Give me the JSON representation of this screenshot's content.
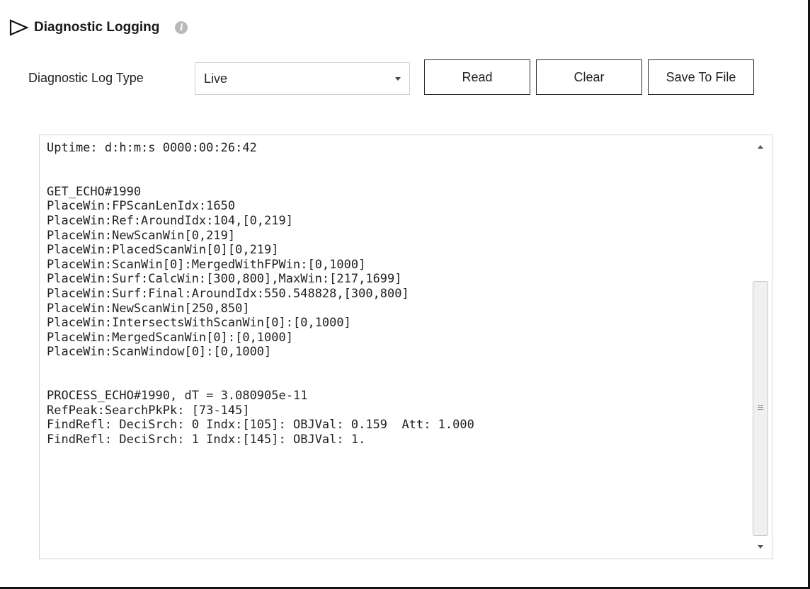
{
  "header": {
    "title": "Diagnostic Logging",
    "expand_icon": "play-triangle-outline",
    "info_icon": "info-circle",
    "info_glyph": "i"
  },
  "controls": {
    "log_type_label": "Diagnostic Log Type",
    "log_type_value": "Live",
    "read_label": "Read",
    "clear_label": "Clear",
    "save_label": "Save To File"
  },
  "log": {
    "lines": [
      "Uptime: d:h:m:s 0000:00:26:42",
      "",
      "",
      "GET_ECHO#1990",
      "PlaceWin:FPScanLenIdx:1650",
      "PlaceWin:Ref:AroundIdx:104,[0,219]",
      "PlaceWin:NewScanWin[0,219]",
      "PlaceWin:PlacedScanWin[0][0,219]",
      "PlaceWin:ScanWin[0]:MergedWithFPWin:[0,1000]",
      "PlaceWin:Surf:CalcWin:[300,800],MaxWin:[217,1699]",
      "PlaceWin:Surf:Final:AroundIdx:550.548828,[300,800]",
      "PlaceWin:NewScanWin[250,850]",
      "PlaceWin:IntersectsWithScanWin[0]:[0,1000]",
      "PlaceWin:MergedScanWin[0]:[0,1000]",
      "PlaceWin:ScanWindow[0]:[0,1000]",
      "",
      "",
      "PROCESS_ECHO#1990, dT = 3.080905e-11",
      "RefPeak:SearchPkPk: [73-145]",
      "FindRefl: DeciSrch: 0 Indx:[105]: OBJVal: 0.159  Att: 1.000",
      "FindRefl: DeciSrch: 1 Indx:[145]: OBJVal: 1."
    ]
  },
  "colors": {
    "border": "#111111",
    "info_icon_bg": "#b9b9b9",
    "text": "#222222"
  }
}
